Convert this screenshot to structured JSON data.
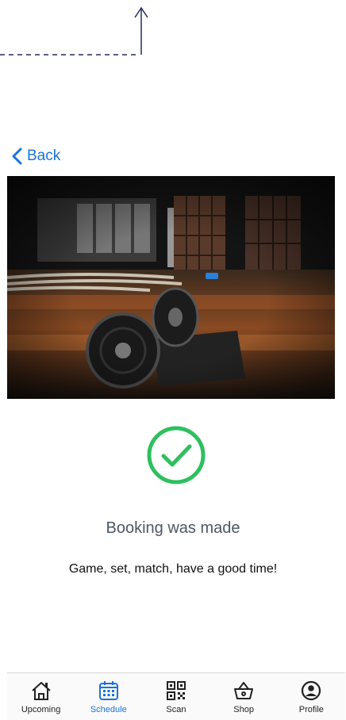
{
  "nav": {
    "back_label": "Back"
  },
  "status": {
    "title": "Booking was made",
    "message": "Game, set, match, have a good time!"
  },
  "tabs": [
    {
      "label": "Upcoming",
      "icon": "home-icon",
      "active": false
    },
    {
      "label": "Schedule",
      "icon": "calendar-icon",
      "active": true
    },
    {
      "label": "Scan",
      "icon": "qr-code-icon",
      "active": false
    },
    {
      "label": "Shop",
      "icon": "basket-icon",
      "active": false
    },
    {
      "label": "Profile",
      "icon": "profile-icon",
      "active": false
    }
  ],
  "colors": {
    "accent": "#1a73d9",
    "success": "#2fbf5f",
    "title_text": "#4d5763"
  }
}
